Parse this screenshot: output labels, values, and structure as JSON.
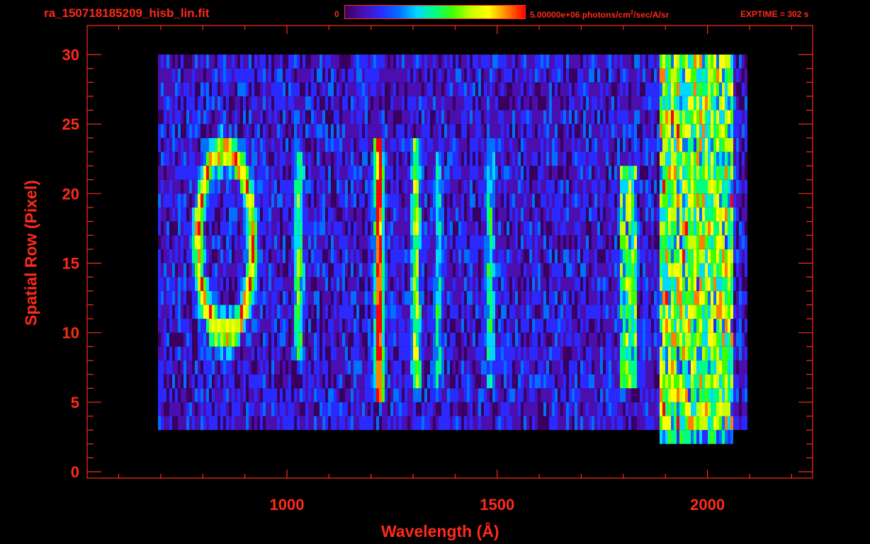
{
  "header": {
    "filename": "ra_150718185209_hisb_lin.fit",
    "colorbar_min": "0",
    "colorbar_max_value": "5.00000e+06",
    "colorbar_max_unit_pre": "photons/cm",
    "colorbar_max_unit_sup": "2",
    "colorbar_max_unit_post": "/sec/A/sr",
    "exptime": "EXPTIME = 302 s"
  },
  "colors": {
    "axis": "#ff2a1a",
    "background": "#000000",
    "colormap": [
      "#000000",
      "#3a0060",
      "#4b0fb0",
      "#2a2aff",
      "#0070ff",
      "#00d8ff",
      "#00ff80",
      "#40ff00",
      "#c8ff00",
      "#ffff00",
      "#ff8000",
      "#ff0000"
    ]
  },
  "chart_data": {
    "type": "heatmap",
    "title": "",
    "xlabel": "Wavelength (Å)",
    "ylabel": "Spatial Row (Pixel)",
    "xlim": [
      525,
      2250
    ],
    "ylim": [
      0,
      30
    ],
    "xticks": [
      1000,
      1500,
      2000
    ],
    "yticks": [
      0,
      5,
      10,
      15,
      20,
      25,
      30
    ],
    "color_range": [
      0,
      5000000
    ],
    "color_unit": "photons/cm^2/sec/A/sr",
    "grid": false,
    "features": [
      {
        "kind": "continuum",
        "x_range": [
          690,
          2090
        ],
        "y_range": [
          3,
          30
        ],
        "level": 0.22
      },
      {
        "kind": "emission_line",
        "wavelength": 1216,
        "y_range": [
          5,
          24
        ],
        "level": 1.0
      },
      {
        "kind": "emission_line",
        "wavelength": 1304,
        "y_range": [
          6,
          24
        ],
        "level": 0.55
      },
      {
        "kind": "emission_line",
        "wavelength": 1025,
        "y_range": [
          8,
          23
        ],
        "level": 0.45
      },
      {
        "kind": "emission_line",
        "wavelength": 1480,
        "y_range": [
          6,
          23
        ],
        "level": 0.35
      },
      {
        "kind": "emission_line",
        "wavelength": 1356,
        "y_range": [
          6,
          23
        ],
        "level": 0.3
      },
      {
        "kind": "band",
        "x_range": [
          1790,
          1830
        ],
        "y_range": [
          6,
          22
        ],
        "level": 0.5
      },
      {
        "kind": "band",
        "x_range": [
          1880,
          2060
        ],
        "y_range": [
          2,
          30
        ],
        "level": 0.6
      },
      {
        "kind": "ring",
        "center": [
          850,
          16.5
        ],
        "radius_x": 65,
        "radius_y": 6.5,
        "level": 0.72
      }
    ]
  }
}
